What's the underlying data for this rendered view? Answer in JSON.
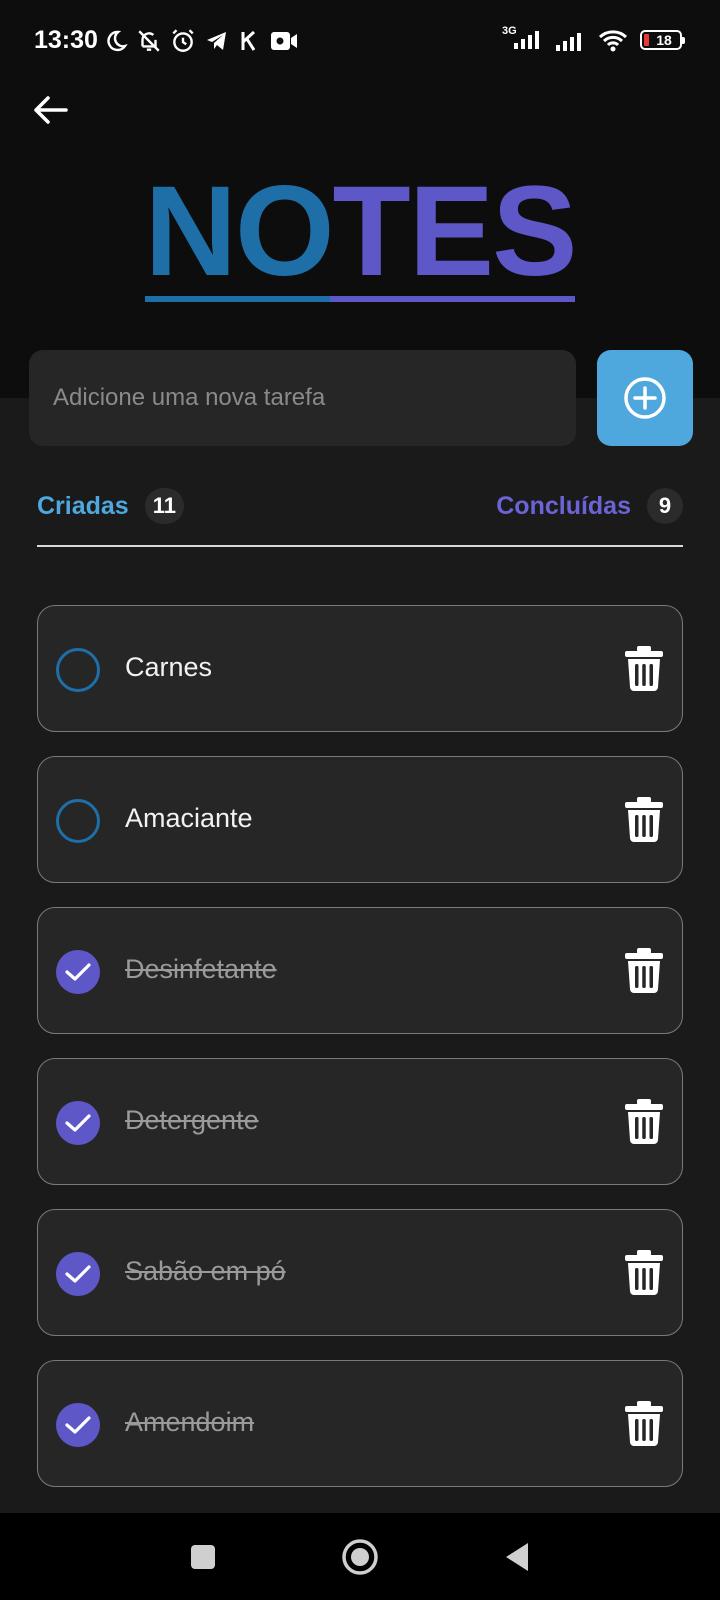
{
  "status_bar": {
    "time": "13:30",
    "network": "3G",
    "battery": "18",
    "icons": [
      "moon-icon",
      "bell-off-icon",
      "alarm-icon",
      "telegram-icon",
      "k-app-icon",
      "video-record-icon",
      "signal-icon",
      "signal-icon",
      "wifi-icon",
      "battery-icon"
    ]
  },
  "header": {
    "title_part1": "NO",
    "title_part2": "TES"
  },
  "new_task": {
    "placeholder": "Adicione uma nova tarefa",
    "value": ""
  },
  "counters": {
    "created_label": "Criadas",
    "created_count": "11",
    "done_label": "Concluídas",
    "done_count": "9"
  },
  "tasks": [
    {
      "text": "Carnes",
      "done": false
    },
    {
      "text": "Amaciante",
      "done": false
    },
    {
      "text": "Desinfetante",
      "done": true
    },
    {
      "text": "Detergente",
      "done": true
    },
    {
      "text": "Sabão em pó",
      "done": true
    },
    {
      "text": "Amendoim",
      "done": true
    }
  ],
  "colors": {
    "accent_blue": "#4ea8de",
    "accent_purple": "#5e57c8",
    "logo_blue": "#1e6fa8",
    "background": "#1a1a1a",
    "card": "#262626"
  },
  "nav": [
    "recents-icon",
    "home-icon",
    "back-triangle-icon"
  ]
}
